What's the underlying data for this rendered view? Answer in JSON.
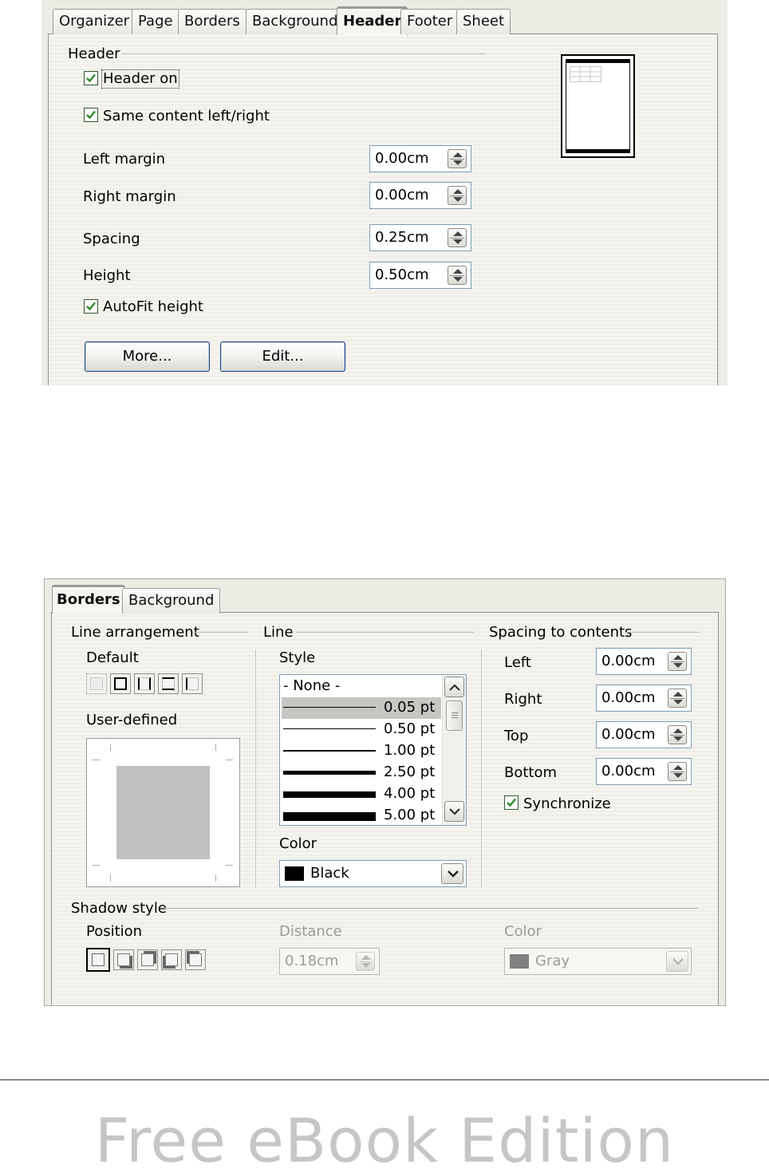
{
  "page_style_dialog": {
    "tabs": [
      {
        "label": "Organizer"
      },
      {
        "label": "Page"
      },
      {
        "label": "Borders"
      },
      {
        "label": "Background"
      },
      {
        "label": "Header",
        "active": true
      },
      {
        "label": "Footer"
      },
      {
        "label": "Sheet"
      }
    ],
    "section_title": "Header",
    "header_on": {
      "label": "Header on",
      "checked": true
    },
    "same_content": {
      "label": "Same content left/right",
      "checked": true
    },
    "left_margin": {
      "label": "Left margin",
      "value": "0.00cm"
    },
    "right_margin": {
      "label": "Right margin",
      "value": "0.00cm"
    },
    "spacing": {
      "label": "Spacing",
      "value": "0.25cm"
    },
    "height": {
      "label": "Height",
      "value": "0.50cm"
    },
    "autofit": {
      "label": "AutoFit height",
      "checked": true
    },
    "more_button": "More...",
    "edit_button": "Edit..."
  },
  "border_dialog": {
    "tabs": [
      {
        "label": "Borders",
        "active": true
      },
      {
        "label": "Background"
      }
    ],
    "line_arrangement": {
      "title": "Line arrangement",
      "default_label": "Default",
      "user_defined_label": "User-defined"
    },
    "line": {
      "title": "Line",
      "style_label": "Style",
      "styles": [
        "- None -",
        "0.05 pt",
        "0.50 pt",
        "1.00 pt",
        "2.50 pt",
        "4.00 pt",
        "5.00 pt"
      ],
      "selected_style": "0.05 pt",
      "color_label": "Color",
      "color_value": "Black",
      "color_hex": "#000000"
    },
    "spacing": {
      "title": "Spacing to contents",
      "left": {
        "label": "Left",
        "value": "0.00cm"
      },
      "right": {
        "label": "Right",
        "value": "0.00cm"
      },
      "top": {
        "label": "Top",
        "value": "0.00cm"
      },
      "bottom": {
        "label": "Bottom",
        "value": "0.00cm"
      },
      "synchronize": {
        "label": "Synchronize",
        "checked": true
      }
    },
    "shadow": {
      "title": "Shadow style",
      "position_label": "Position",
      "distance_label": "Distance",
      "distance_value": "0.18cm",
      "color_label": "Color",
      "color_value": "Gray",
      "color_hex": "#808080"
    }
  },
  "watermark": "Free eBook Edition"
}
